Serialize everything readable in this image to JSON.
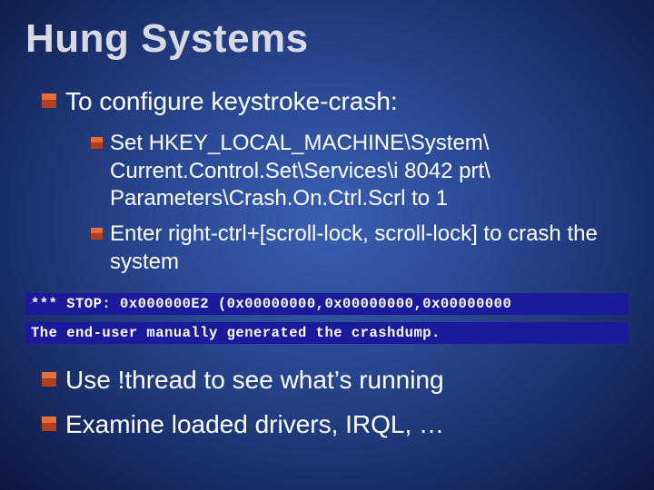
{
  "title": "Hung Systems",
  "bullets": {
    "configure": "To configure keystroke-crash:",
    "set_reg": "Set HKEY_LOCAL_MACHINE\\System\\ Current.Control.Set\\Services\\i 8042 prt\\ Parameters\\Crash.On.Ctrl.Scrl to 1",
    "enter_keys": "Enter right-ctrl+[scroll-lock, scroll-lock] to crash the system",
    "use_thread": "Use !thread to see what’s running",
    "examine": "Examine loaded drivers, IRQL, …"
  },
  "crashdump": {
    "line1": "*** STOP: 0x000000E2 (0x00000000,0x00000000,0x00000000",
    "line2": "The end-user manually generated the crashdump."
  }
}
